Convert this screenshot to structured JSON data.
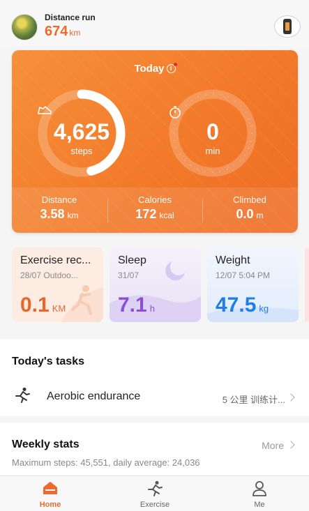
{
  "header": {
    "distance_label": "Distance run",
    "distance_value": "674",
    "distance_unit": "km",
    "avatar_icon": "user-avatar-photo",
    "device_icon": "smart-band-icon"
  },
  "today_card": {
    "title": "Today",
    "info_icon": "i",
    "steps": {
      "value": "4,625",
      "unit": "steps",
      "progress": 0.46,
      "icon": "shoe-icon"
    },
    "minutes": {
      "value": "0",
      "unit": "min",
      "progress": 0,
      "icon": "stopwatch-icon"
    },
    "stats": [
      {
        "label": "Distance",
        "value": "3.58",
        "unit": "km"
      },
      {
        "label": "Calories",
        "value": "172",
        "unit": "kcal"
      },
      {
        "label": "Climbed",
        "value": "0.0",
        "unit": "m"
      }
    ]
  },
  "tiles": {
    "exercise": {
      "title": "Exercise rec...",
      "subtitle": "28/07 Outdoo...",
      "value": "0.1",
      "unit": "KM",
      "color": "#e8662a"
    },
    "sleep": {
      "title": "Sleep",
      "subtitle": "31/07",
      "value": "7.1",
      "unit": "h",
      "color": "#8a4fd6"
    },
    "weight": {
      "title": "Weight",
      "subtitle": "12/07 5:04 PM",
      "value": "47.5",
      "unit": "kg",
      "color": "#1f7fe6"
    }
  },
  "tasks": {
    "title": "Today's tasks",
    "item": {
      "name": "Aerobic endurance",
      "plan": "5 公里 训练计...",
      "icon": "running-person-icon"
    }
  },
  "weekly": {
    "title": "Weekly stats",
    "more": "More",
    "description": "Maximum steps: 45,551, daily average: 24,036"
  },
  "nav": {
    "home": "Home",
    "exercise": "Exercise",
    "me": "Me",
    "active_color": "#ec6a2b"
  }
}
